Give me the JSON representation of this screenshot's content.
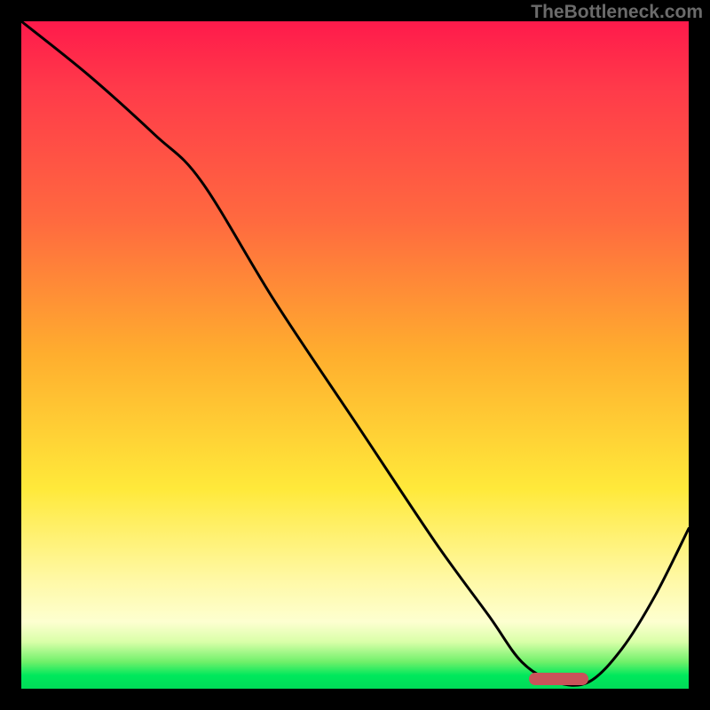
{
  "watermark": "TheBottleneck.com",
  "chart_data": {
    "type": "line",
    "title": "",
    "xlabel": "",
    "ylabel": "",
    "xlim": [
      0,
      100
    ],
    "ylim": [
      0,
      100
    ],
    "series": [
      {
        "name": "bottleneck-curve",
        "x": [
          0,
          10,
          20,
          27,
          38,
          50,
          62,
          70,
          75,
          80,
          85,
          90,
          95,
          100
        ],
        "values": [
          100,
          92,
          83,
          76,
          58,
          40,
          22,
          11,
          4,
          1,
          1,
          6,
          14,
          24
        ]
      }
    ],
    "marker": {
      "name": "optimal-range",
      "x_start": 76,
      "x_end": 85,
      "y": 1.5
    },
    "gradient_scale": {
      "top_color": "#ff1a4b",
      "mid_color": "#ffe93a",
      "bottom_color": "#00db58",
      "meaning_top": "high-bottleneck",
      "meaning_bottom": "no-bottleneck"
    }
  }
}
